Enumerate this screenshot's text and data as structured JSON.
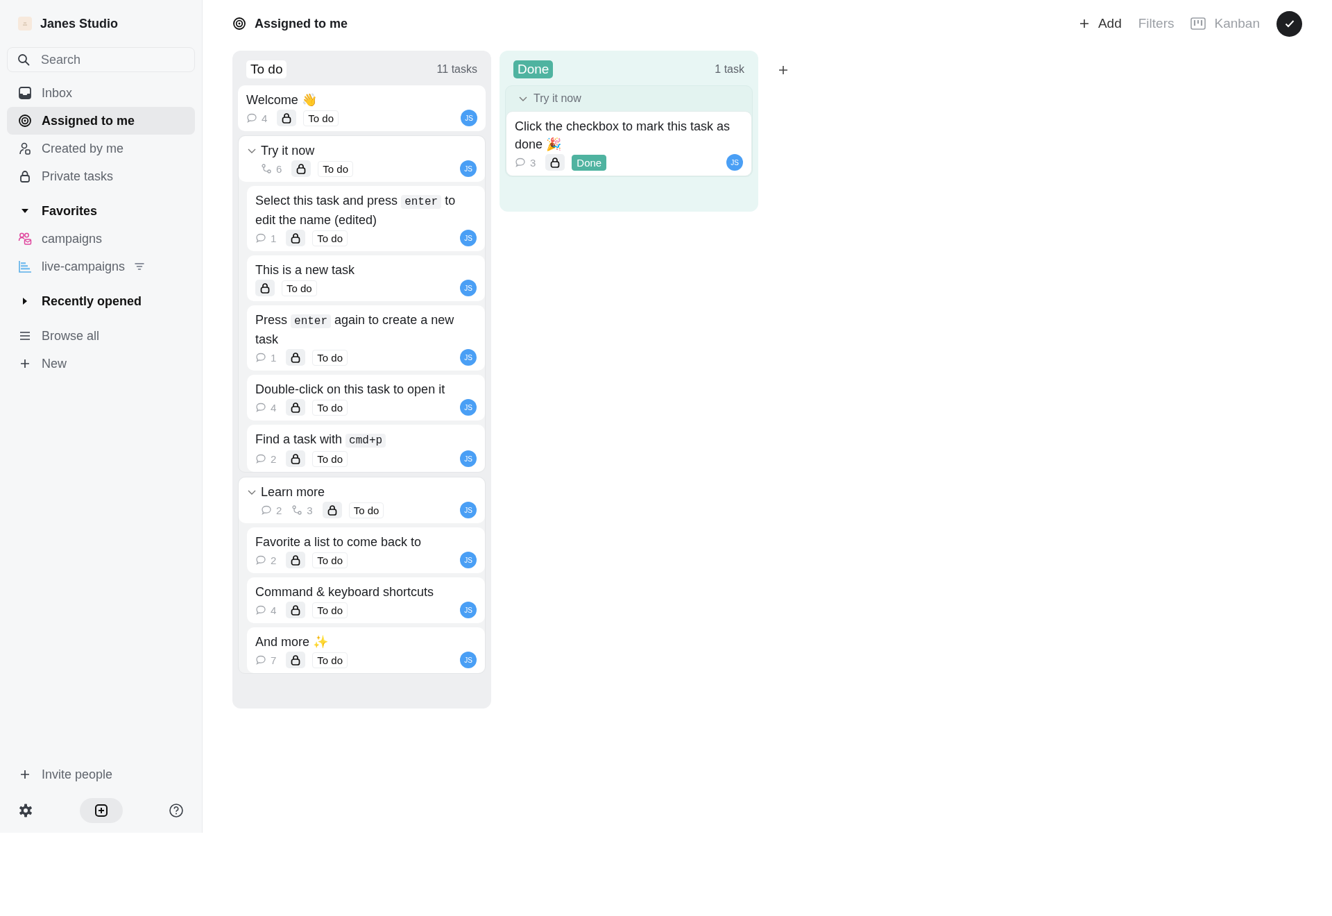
{
  "workspace": {
    "name": "Janes Studio"
  },
  "search": {
    "placeholder": "Search"
  },
  "nav": [
    {
      "label": "Inbox",
      "kind": "inbox",
      "selected": false
    },
    {
      "label": "Assigned to me",
      "kind": "target",
      "selected": true
    },
    {
      "label": "Created by me",
      "kind": "person",
      "selected": false
    },
    {
      "label": "Private tasks",
      "kind": "lock",
      "selected": false
    }
  ],
  "sections": [
    {
      "title": "Favorites",
      "expanded": true,
      "items": [
        {
          "label": "campaigns",
          "kind": "people",
          "filtered": false
        },
        {
          "label": "live-campaigns",
          "kind": "chart",
          "filtered": true
        }
      ]
    },
    {
      "title": "Recently opened",
      "expanded": false
    }
  ],
  "links": [
    {
      "label": "Browse all",
      "kind": "menu"
    },
    {
      "label": "New",
      "kind": "plus"
    }
  ],
  "invite": {
    "label": "Invite people"
  },
  "header": {
    "title": "Assigned to me",
    "actions": [
      {
        "label": "Add",
        "kind": "add"
      },
      {
        "label": "Filters",
        "kind": "filters"
      },
      {
        "label": "Kanban",
        "kind": "view"
      }
    ]
  },
  "columns": [
    {
      "title": "To do",
      "count": "11 tasks",
      "kind": "todo",
      "cards": [
        {
          "kind": "task",
          "title": [
            {
              "kind": "text",
              "text": "Welcome 👋"
            }
          ],
          "comments": "4",
          "status": "To do",
          "done": false,
          "assignee": "JS"
        },
        {
          "kind": "group",
          "title": [
            {
              "kind": "text",
              "text": "Try it now"
            }
          ],
          "expanded": true,
          "subtasks": "6",
          "status": "To do",
          "done": false,
          "assignee": "JS",
          "children": [
            {
              "kind": "task",
              "title": [
                {
                  "kind": "text",
                  "text": "Select this task and press"
                },
                {
                  "kind": "code",
                  "text": "enter"
                },
                {
                  "kind": "text",
                  "text": "to edit the name (edited)"
                }
              ],
              "comments": "1",
              "status": "To do",
              "done": false,
              "assignee": "JS"
            },
            {
              "kind": "task",
              "title": [
                {
                  "kind": "text",
                  "text": "This is a new task"
                }
              ],
              "status": "To do",
              "done": false,
              "assignee": "JS"
            },
            {
              "kind": "task",
              "title": [
                {
                  "kind": "text",
                  "text": "Press"
                },
                {
                  "kind": "code",
                  "text": "enter"
                },
                {
                  "kind": "text",
                  "text": "again to create a new task"
                }
              ],
              "comments": "1",
              "status": "To do",
              "done": false,
              "assignee": "JS"
            },
            {
              "kind": "task",
              "title": [
                {
                  "kind": "text",
                  "text": "Double-click on this task to open it"
                }
              ],
              "comments": "4",
              "status": "To do",
              "done": false,
              "assignee": "JS"
            },
            {
              "kind": "task",
              "title": [
                {
                  "kind": "text",
                  "text": "Find a task with"
                },
                {
                  "kind": "code",
                  "text": "cmd+p"
                }
              ],
              "comments": "2",
              "status": "To do",
              "done": false,
              "assignee": "JS"
            }
          ]
        },
        {
          "kind": "group",
          "title": [
            {
              "kind": "text",
              "text": "Learn more"
            }
          ],
          "expanded": true,
          "comments": "2",
          "subtasks": "3",
          "status": "To do",
          "done": false,
          "assignee": "JS",
          "children": [
            {
              "kind": "task",
              "title": [
                {
                  "kind": "text",
                  "text": "Favorite a list to come back to"
                }
              ],
              "comments": "2",
              "status": "To do",
              "done": false,
              "assignee": "JS"
            },
            {
              "kind": "task",
              "title": [
                {
                  "kind": "text",
                  "text": "Command & keyboard shortcuts"
                }
              ],
              "comments": "4",
              "status": "To do",
              "done": false,
              "assignee": "JS"
            },
            {
              "kind": "task",
              "title": [
                {
                  "kind": "text",
                  "text": "And more ✨"
                }
              ],
              "comments": "7",
              "status": "To do",
              "done": false,
              "assignee": "JS"
            }
          ]
        }
      ]
    },
    {
      "title": "Done",
      "count": "1 task",
      "kind": "done",
      "cards": [
        {
          "kind": "parent",
          "title": [
            {
              "kind": "text",
              "text": "Try it now"
            }
          ],
          "expanded": true,
          "children": [
            {
              "kind": "task",
              "title": [
                {
                  "kind": "text",
                  "text": "Click the checkbox to mark this task as done 🎉"
                }
              ],
              "comments": "3",
              "status": "Done",
              "done": true,
              "assignee": "JS"
            }
          ]
        }
      ]
    }
  ]
}
